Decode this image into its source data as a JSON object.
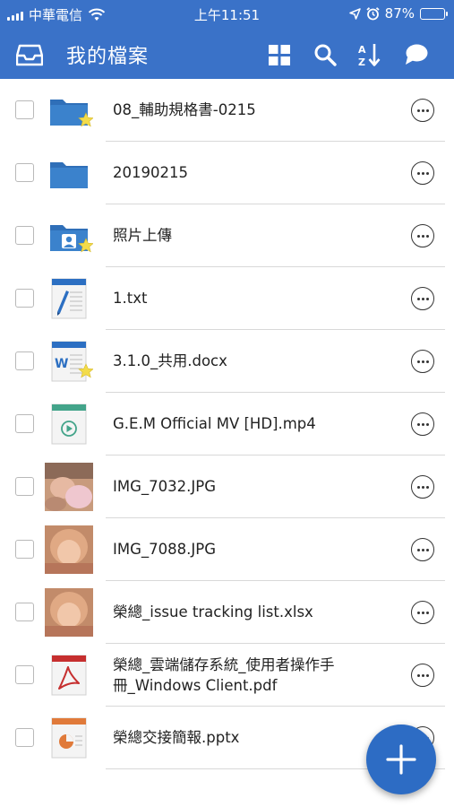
{
  "status_bar": {
    "carrier": "中華電信",
    "time": "上午11:51",
    "battery": "87%",
    "battery_level": 0.87
  },
  "toolbar": {
    "title": "我的檔案",
    "icons": [
      "inbox-icon",
      "grid-view-icon",
      "search-icon",
      "sort-az-icon",
      "chat-bubble-icon"
    ]
  },
  "files": [
    {
      "name": "08_輔助規格書-0215",
      "type": "folder",
      "starred": true
    },
    {
      "name": "20190215",
      "type": "folder",
      "starred": false
    },
    {
      "name": "照片上傳",
      "type": "photo-folder",
      "starred": true
    },
    {
      "name": "1.txt",
      "type": "txt",
      "starred": false
    },
    {
      "name": "3.1.0_共用.docx",
      "type": "docx",
      "starred": true
    },
    {
      "name": "G.E.M Official MV [HD].mp4",
      "type": "video",
      "starred": false
    },
    {
      "name": "IMG_7032.JPG",
      "type": "image",
      "starred": false
    },
    {
      "name": "IMG_7088.JPG",
      "type": "image",
      "starred": false
    },
    {
      "name": "榮總_issue tracking list.xlsx",
      "type": "image",
      "starred": false
    },
    {
      "name": "榮總_雲端儲存系統_使用者操作手",
      "name_line2": "冊_Windows Client.pdf",
      "type": "pdf",
      "starred": false
    },
    {
      "name": "榮總交接簡報.pptx",
      "type": "pptx",
      "starred": false
    }
  ],
  "colors": {
    "header": "#3a72c8",
    "folder": "#3b82cc",
    "fab": "#2d6cc4",
    "star": "#f3dc4a"
  }
}
